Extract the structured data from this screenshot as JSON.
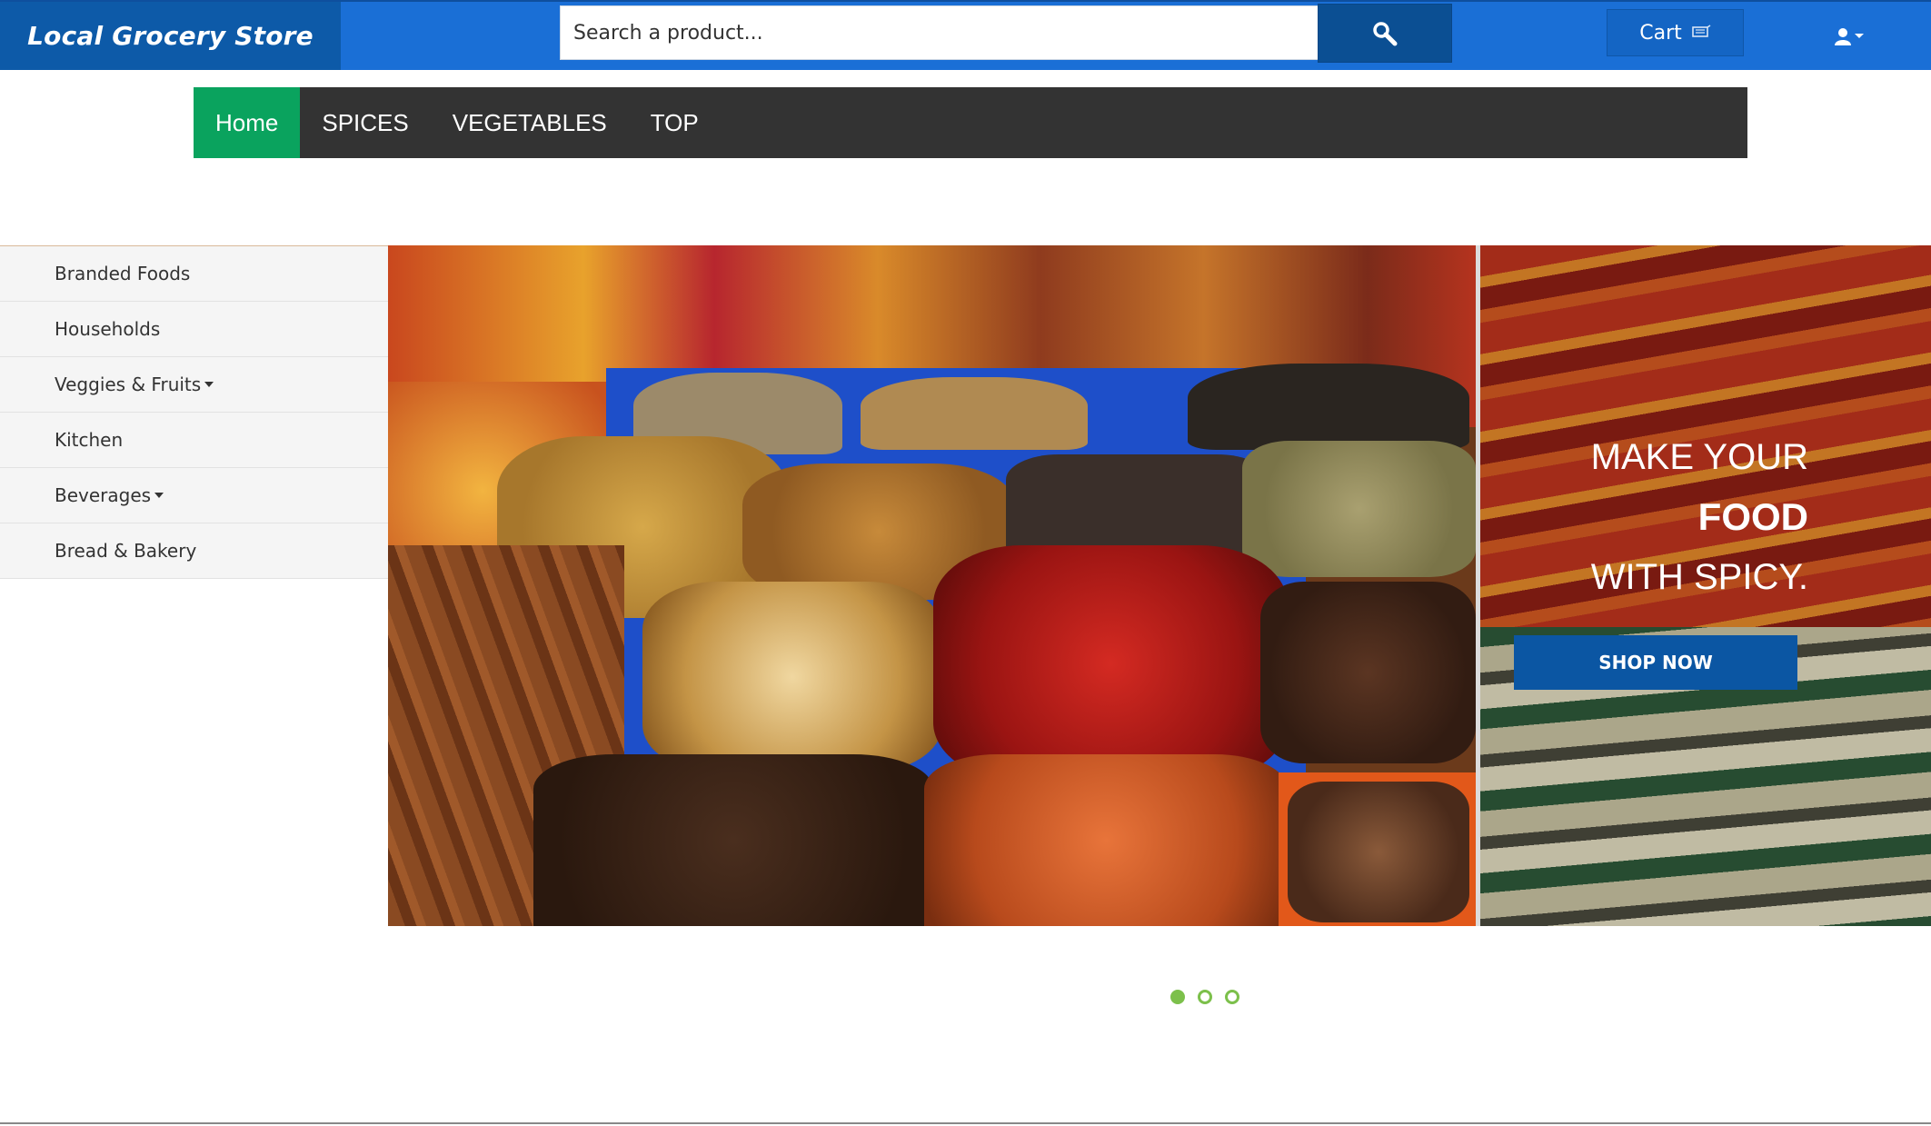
{
  "brand": {
    "name": "Local Grocery Store"
  },
  "search": {
    "placeholder": "Search a product..."
  },
  "header": {
    "cart_label": "Cart"
  },
  "nav": {
    "items": [
      {
        "label": "Home",
        "active": true
      },
      {
        "label": "SPICES"
      },
      {
        "label": "VEGETABLES"
      },
      {
        "label": "TOP"
      }
    ]
  },
  "sidebar": {
    "items": [
      {
        "label": "Branded Foods"
      },
      {
        "label": "Households"
      },
      {
        "label": "Veggies & Fruits"
      },
      {
        "label": "Kitchen"
      },
      {
        "label": "Beverages"
      },
      {
        "label": "Bread & Bakery"
      }
    ]
  },
  "promo": {
    "line1": "MAKE YOUR",
    "line2": "FOOD",
    "line3": "WITH SPICY.",
    "button_label": "SHOP NOW"
  },
  "carousel": {
    "slide_count": 3,
    "active_index": 0
  },
  "colors": {
    "topbar": "#1a6fd6",
    "brand_bg": "#0d5aa8",
    "nav_bg": "#333333",
    "nav_active": "#0aa35e",
    "dot": "#7cc04b"
  }
}
